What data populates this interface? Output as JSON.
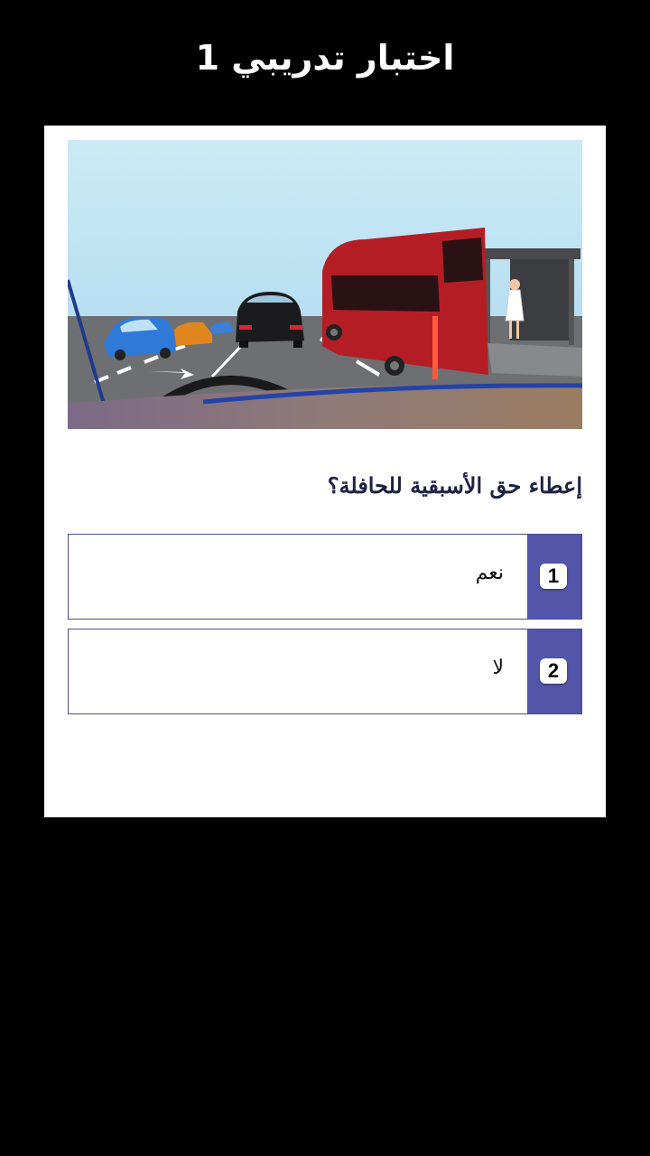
{
  "header": {
    "title": "اختبار تدريبي 1"
  },
  "quiz": {
    "image_icon": "road-scene-bus-illustration",
    "question": "إعطاء حق الأسبقية للحافلة؟",
    "answers": [
      {
        "number": "1",
        "label": "نعم"
      },
      {
        "number": "2",
        "label": "لا"
      }
    ]
  },
  "colors": {
    "background": "#000000",
    "card": "#ffffff",
    "accent": "#5355a8",
    "question_text": "#1c2240"
  }
}
